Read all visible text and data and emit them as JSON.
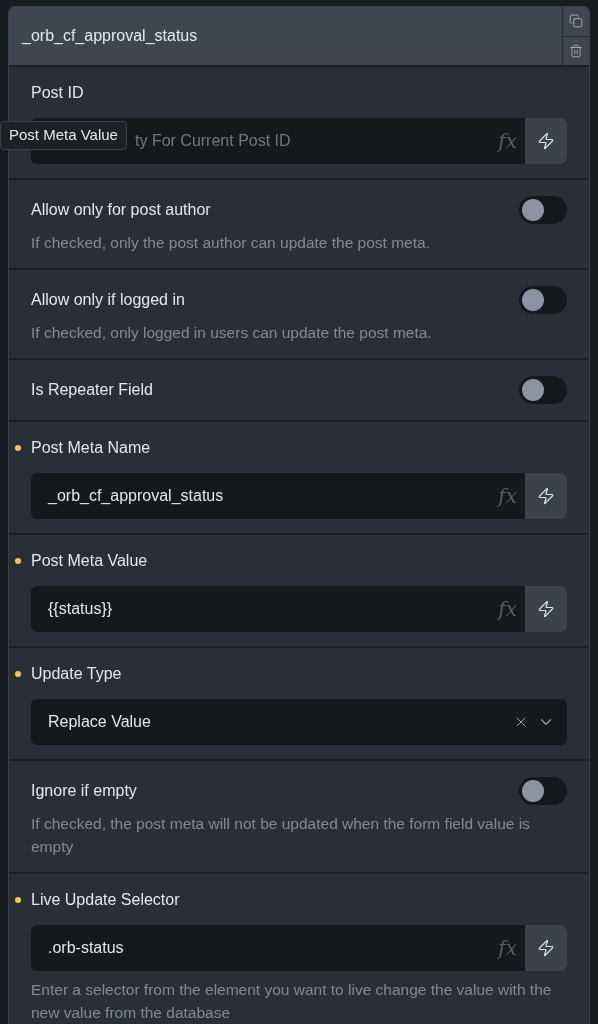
{
  "header": {
    "title": "_orb_cf_approval_status"
  },
  "tooltip": {
    "text": "Post Meta Value"
  },
  "sections": [
    {
      "kind": "input",
      "label": "Post ID",
      "required": false,
      "placeholder": "ty For Current Post ID",
      "fx": "fx"
    },
    {
      "kind": "toggle",
      "label": "Allow only for post author",
      "required": false,
      "on": false,
      "description": "If checked, only the post author can update the post meta."
    },
    {
      "kind": "toggle",
      "label": "Allow only if logged in",
      "required": false,
      "on": false,
      "description": "If checked, only logged in users can update the post meta."
    },
    {
      "kind": "toggle",
      "label": "Is Repeater Field",
      "required": false,
      "on": false
    },
    {
      "kind": "input",
      "label": "Post Meta Name",
      "required": true,
      "value": "_orb_cf_approval_status",
      "fx": "fx"
    },
    {
      "kind": "input",
      "label": "Post Meta Value",
      "required": true,
      "value": "{{status}}",
      "fx": "fx"
    },
    {
      "kind": "select",
      "label": "Update Type",
      "required": true,
      "value": "Replace Value"
    },
    {
      "kind": "toggle",
      "label": "Ignore if empty",
      "required": false,
      "on": false,
      "description": "If checked, the post meta will not be updated when the form field value is empty"
    },
    {
      "kind": "input",
      "label": "Live Update Selector",
      "required": true,
      "value": ".orb-status",
      "fx": "fx",
      "description": "Enter a selector from the element you want to live change the value with the new value from the database"
    }
  ]
}
